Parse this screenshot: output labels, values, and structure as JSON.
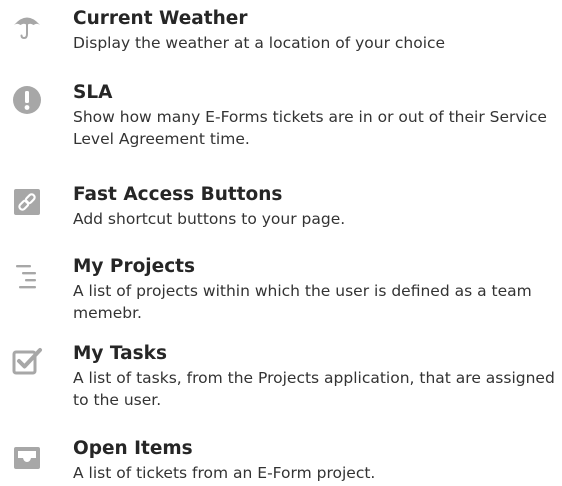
{
  "widgets": [
    {
      "title": "Current Weather",
      "description": "Display the weather at a location of your choice",
      "icon": "umbrella-icon"
    },
    {
      "title": "SLA",
      "description": "Show how many E-Forms tickets are in or out of their Service Level Agreement time.",
      "icon": "exclamation-icon"
    },
    {
      "title": "Fast Access Buttons",
      "description": "Add shortcut buttons to your page.",
      "icon": "link-icon"
    },
    {
      "title": "My Projects",
      "description": "A list of projects within which the user is defined as a team memebr.",
      "icon": "indent-list-icon"
    },
    {
      "title": "My Tasks",
      "description": "A list of tasks, from the Projects application, that are assigned to the user.",
      "icon": "check-square-icon"
    },
    {
      "title": "Open Items",
      "description": "A list of tickets from an E-Form project.",
      "icon": "inbox-tray-icon"
    }
  ],
  "colors": {
    "icon_gray": "#a7a7a7",
    "title": "#262626",
    "description": "#333333"
  }
}
